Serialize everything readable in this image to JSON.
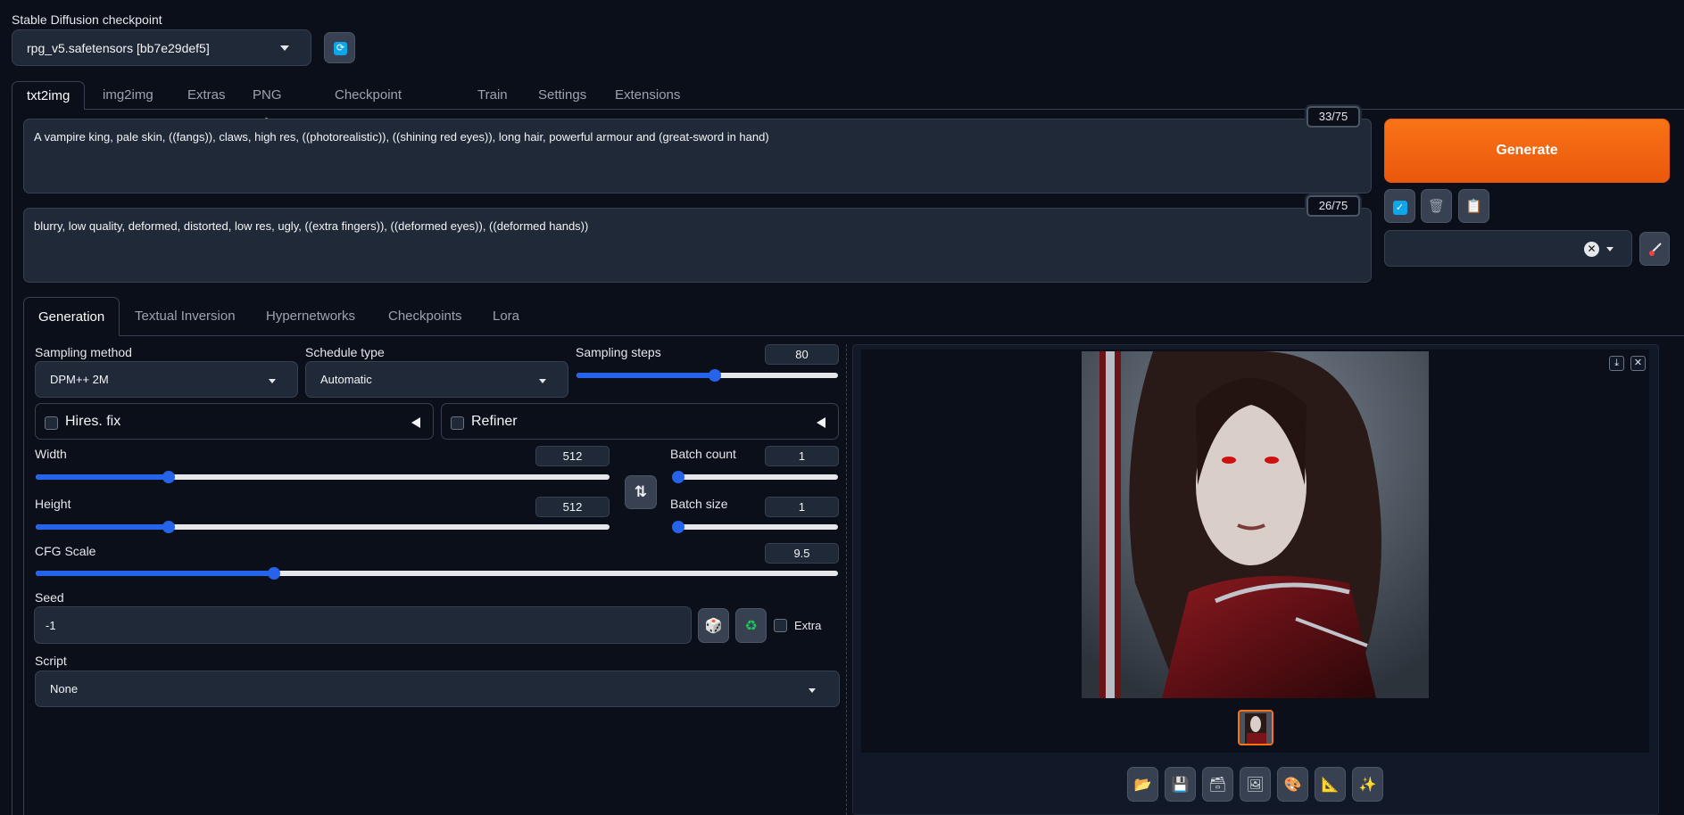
{
  "checkpoint": {
    "label": "Stable Diffusion checkpoint",
    "value": "rpg_v5.safetensors [bb7e29def5]"
  },
  "main_tabs": [
    "txt2img",
    "img2img",
    "Extras",
    "PNG Info",
    "Checkpoint Merger",
    "Train",
    "Settings",
    "Extensions"
  ],
  "prompt": {
    "text": "A vampire king, pale skin, ((fangs)), claws, high res, ((photorealistic)), ((shining red eyes)), long hair, powerful armour and (great-sword in hand)",
    "counter": "33/75"
  },
  "negative_prompt": {
    "text": "blurry, low quality, deformed, distorted, low res, ugly, ((extra fingers)), ((deformed eyes)), ((deformed hands))",
    "counter": "26/75"
  },
  "generate_label": "Generate",
  "sub_tabs": [
    "Generation",
    "Textual Inversion",
    "Hypernetworks",
    "Checkpoints",
    "Lora"
  ],
  "generation": {
    "sampling_method": {
      "label": "Sampling method",
      "value": "DPM++ 2M"
    },
    "schedule_type": {
      "label": "Schedule type",
      "value": "Automatic"
    },
    "sampling_steps": {
      "label": "Sampling steps",
      "value": "80",
      "fraction": 0.53
    },
    "hires_fix": {
      "label": "Hires. fix",
      "checked": false
    },
    "refiner": {
      "label": "Refiner",
      "checked": false
    },
    "width": {
      "label": "Width",
      "value": "512",
      "fraction": 0.232
    },
    "height": {
      "label": "Height",
      "value": "512",
      "fraction": 0.232
    },
    "batch_count": {
      "label": "Batch count",
      "value": "1",
      "fraction": 0.0
    },
    "batch_size": {
      "label": "Batch size",
      "value": "1",
      "fraction": 0.0
    },
    "cfg_scale": {
      "label": "CFG Scale",
      "value": "9.5",
      "fraction": 0.297
    },
    "seed": {
      "label": "Seed",
      "value": "-1"
    },
    "extra_label": "Extra",
    "script": {
      "label": "Script",
      "value": "None"
    }
  },
  "icons": {
    "refresh": "refresh-icon",
    "swap": "swap-dimensions-icon",
    "dice": "dice-icon",
    "recycle": "recycle-icon",
    "folder": "folder-icon",
    "save": "save-icon",
    "zip": "zip-icon",
    "image": "image-icon",
    "palette": "palette-icon",
    "ruler": "ruler-icon",
    "sparkles": "sparkles-icon"
  },
  "colors": {
    "accent": "#f97316",
    "slider": "#2563eb",
    "background": "#0b0f19"
  }
}
